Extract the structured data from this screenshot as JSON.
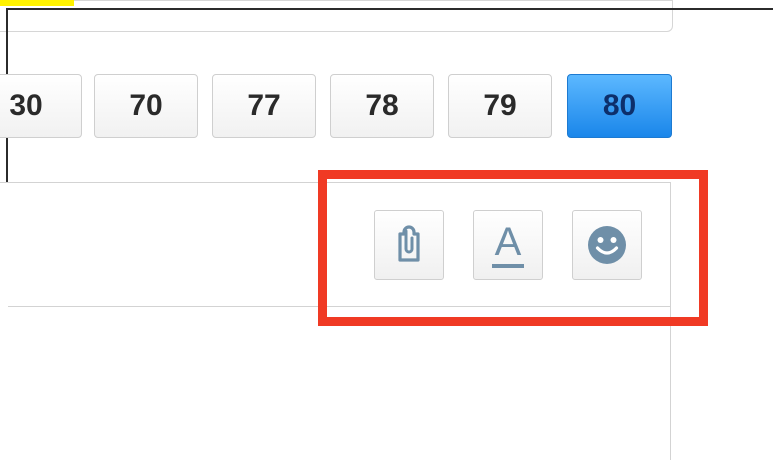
{
  "pagination": {
    "pages": [
      "30",
      "70",
      "77",
      "78",
      "79",
      "80"
    ],
    "active_page": "80",
    "active_color": "#1a86ea"
  },
  "toolbar": {
    "buttons": [
      {
        "icon": "clipboard-paste-icon"
      },
      {
        "icon": "text-format-icon",
        "glyph": "A"
      },
      {
        "icon": "smiley-emoji-icon"
      }
    ],
    "icon_color": "#6f8fa8"
  },
  "annotation": {
    "color": "#f03a24",
    "highlight_color": "#fff200"
  }
}
